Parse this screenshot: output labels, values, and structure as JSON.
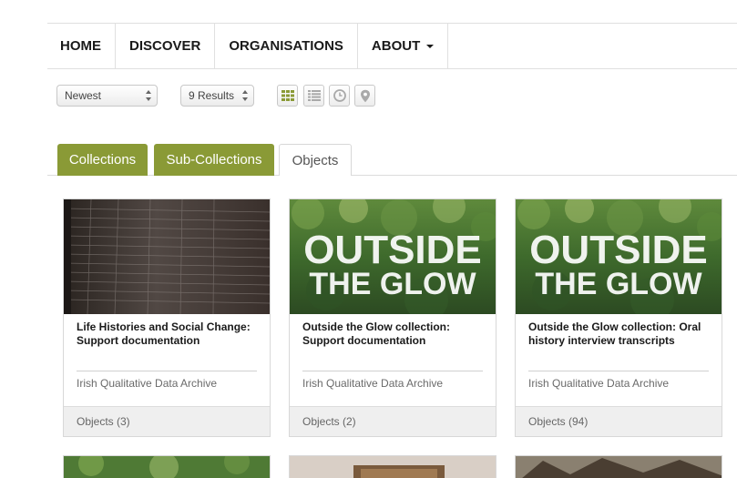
{
  "nav": {
    "items": [
      {
        "label": "HOME"
      },
      {
        "label": "DISCOVER"
      },
      {
        "label": "ORGANISATIONS"
      },
      {
        "label": "ABOUT"
      }
    ]
  },
  "toolbar": {
    "sort_value": "Newest",
    "results_value": "9 Results",
    "views": [
      {
        "icon": "grid-icon",
        "active": true
      },
      {
        "icon": "list-icon",
        "active": false
      },
      {
        "icon": "clock-icon",
        "active": false
      },
      {
        "icon": "map-pin-icon",
        "active": false
      }
    ]
  },
  "tabs": [
    {
      "label": "Collections",
      "active": true
    },
    {
      "label": "Sub-Collections",
      "active": true
    },
    {
      "label": "Objects",
      "active": false
    }
  ],
  "cards": [
    {
      "title": "Life Histories and Social Change: Support documentation",
      "org": "Irish Qualitative Data Archive",
      "objects": "Objects (3)"
    },
    {
      "title": "Outside the Glow collection: Support documentation",
      "org": "Irish Qualitative Data Archive",
      "objects": "Objects (2)",
      "thumb_text_1": "OUTSIDE",
      "thumb_text_2": "THE GLOW"
    },
    {
      "title": "Outside the Glow collection: Oral history interview transcripts",
      "org": "Irish Qualitative Data Archive",
      "objects": "Objects (94)",
      "thumb_text_1": "OUTSIDE",
      "thumb_text_2": "THE GLOW"
    }
  ],
  "colors": {
    "accent": "#8a9a36",
    "nav_text": "#1a1a1a",
    "footer_bg": "#efefef"
  }
}
